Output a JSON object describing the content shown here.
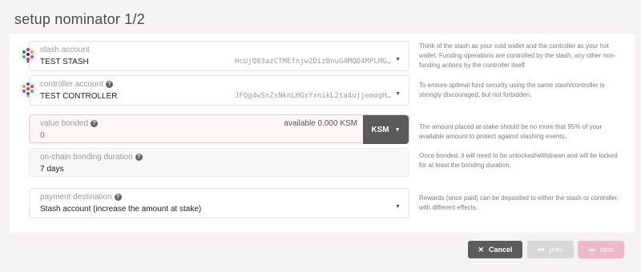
{
  "modal": {
    "title": "setup nominator 1/2"
  },
  "stash": {
    "label": "stash account",
    "name": "TEST STASH",
    "address": "HcUjQ83azCTMEfnjw2DizBnuG4MQD4MPLMG…",
    "info": "Think of the stash as your cold wallet and the controller as your hot wallet. Funding operations are controlled by the stash, any other non-funding actions by the controller itself."
  },
  "controller": {
    "label": "controller account",
    "name": "TEST CONTROLLER",
    "address": "JFQg4wSnZsNknLHGxYxnikL2ta4ujjemogH…",
    "info": "To ensure optimal fund security using the same stash/controller is strongly discouraged, but not forbidden."
  },
  "value_bonded": {
    "label": "value bonded",
    "available": "available 0.000 KSM",
    "value": "0",
    "unit": "KSM",
    "info": "The amount placed at-stake should be no more that 95% of your available amount to protect against slashing events."
  },
  "duration": {
    "label": "on-chain bonding duration",
    "value": "7 days",
    "info": "Once bonded, it will need to be unlocked/withdrawn and will be locked for at least the bonding duration."
  },
  "payment": {
    "label": "payment destination",
    "value": "Stash account (increase the amount at stake)",
    "info": "Rewards (once paid) can be deposited to either the stash or controller, with different effects."
  },
  "actions": {
    "cancel_label": "Cancel",
    "prev_label": "prev",
    "next_label": "next"
  },
  "colors": {
    "primary_disabled": "#f0b9c9",
    "error_bg": "#fff6f6",
    "error_text": "#d9534f"
  }
}
